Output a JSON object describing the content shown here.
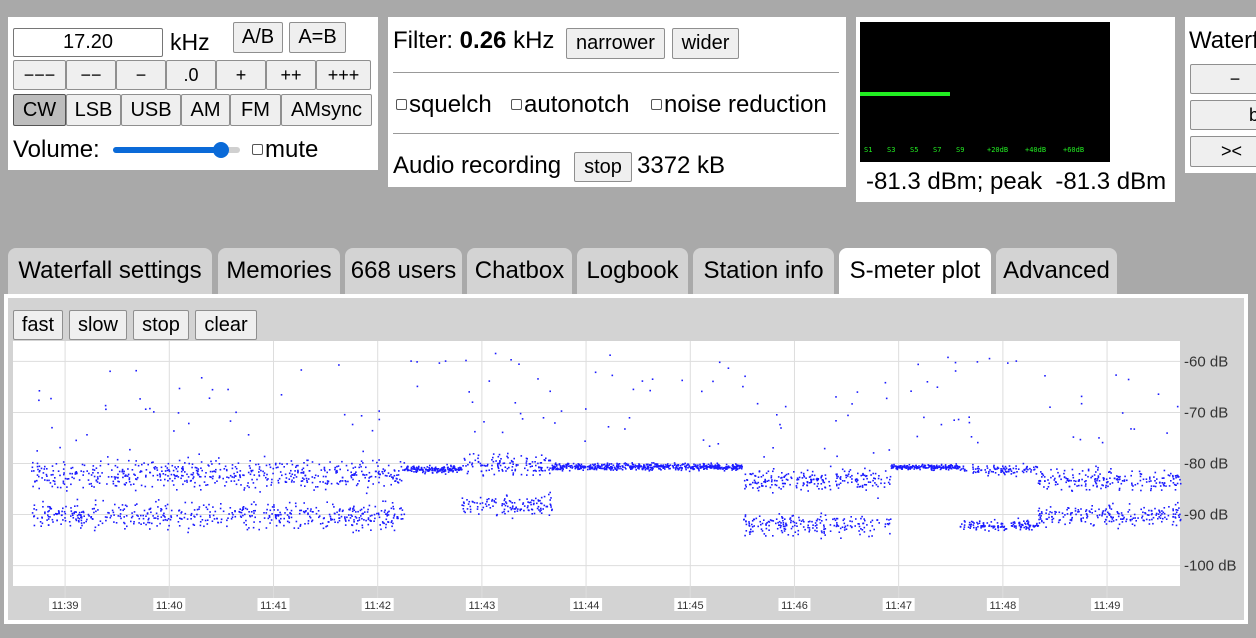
{
  "tuning": {
    "frequency_value": "17.20",
    "unit": "kHz",
    "ab_label": "A/B",
    "aeqb_label": "A=B",
    "step_buttons": [
      "−−−",
      "−−",
      "−",
      ".0",
      "+",
      "++",
      "+++"
    ],
    "modes": [
      "CW",
      "LSB",
      "USB",
      "AM",
      "FM",
      "AMsync"
    ],
    "selected_mode": "CW",
    "volume_label": "Volume:",
    "volume_level": 0.85,
    "mute_label": "mute"
  },
  "filter": {
    "label": "Filter:",
    "value": "0.26",
    "unit": "kHz",
    "narrower_label": "narrower",
    "wider_label": "wider",
    "squelch_label": "squelch",
    "autonotch_label": "autonotch",
    "noise_reduction_label": "noise reduction",
    "recording_label": "Audio recording",
    "stop_label": "stop",
    "recording_size": "3372 kB"
  },
  "smeter": {
    "scale_labels": [
      "S1",
      "S3",
      "S5",
      "S7",
      "S9",
      "+20dB",
      "+40dB",
      "+60dB"
    ],
    "bar_level": 0.36,
    "bar_color": "#22ee22",
    "readout": "-81.3 dBm; peak  -81.3 dBm"
  },
  "waterfall_panel": {
    "title": "Waterf",
    "minus_label": "−",
    "b_label": "b",
    "swap_label": "><"
  },
  "tabs": [
    {
      "label": "Waterfall settings",
      "active": false
    },
    {
      "label": "Memories",
      "active": false
    },
    {
      "label": "668 users",
      "active": false
    },
    {
      "label": "Chatbox",
      "active": false
    },
    {
      "label": "Logbook",
      "active": false
    },
    {
      "label": "Station info",
      "active": false
    },
    {
      "label": "S-meter plot",
      "active": true
    },
    {
      "label": "Advanced",
      "active": false
    }
  ],
  "plot_controls": {
    "fast_label": "fast",
    "slow_label": "slow",
    "stop_label": "stop",
    "clear_label": "clear"
  },
  "chart_data": {
    "type": "scatter",
    "x_ticks": [
      "11:39",
      "11:40",
      "11:41",
      "11:42",
      "11:43",
      "11:44",
      "11:45",
      "11:46",
      "11:47",
      "11:48",
      "11:49"
    ],
    "y_ticks": [
      "-60 dB",
      "-70 dB",
      "-80 dB",
      "-90 dB",
      "-100 dB"
    ],
    "ylim": [
      -104,
      -56
    ],
    "xlim_minutes": [
      "11:38.5",
      "11:49.7"
    ],
    "grid": true,
    "point_color": "#1a1aff",
    "segments": [
      {
        "from": "11:38:40",
        "to": "11:42:15",
        "levels_db": [
          -82,
          -90
        ],
        "spread_db": 4
      },
      {
        "from": "11:42:15",
        "to": "11:42:48",
        "levels_db": [
          -81
        ],
        "spread_db": 1
      },
      {
        "from": "11:42:48",
        "to": "11:43:40",
        "levels_db": [
          -80,
          -88
        ],
        "spread_db": 3
      },
      {
        "from": "11:43:40",
        "to": "11:45:30",
        "levels_db": [
          -80.5
        ],
        "spread_db": 1
      },
      {
        "from": "11:45:30",
        "to": "11:46:55",
        "levels_db": [
          -83,
          -92
        ],
        "spread_db": 3
      },
      {
        "from": "11:46:55",
        "to": "11:47:35",
        "levels_db": [
          -80.5
        ],
        "spread_db": 0.8
      },
      {
        "from": "11:47:35",
        "to": "11:48:20",
        "levels_db": [
          -81,
          -92
        ],
        "spread_db": 1.5
      },
      {
        "from": "11:48:20",
        "to": "11:49:42",
        "levels_db": [
          -83,
          -90
        ],
        "spread_db": 3
      }
    ]
  }
}
